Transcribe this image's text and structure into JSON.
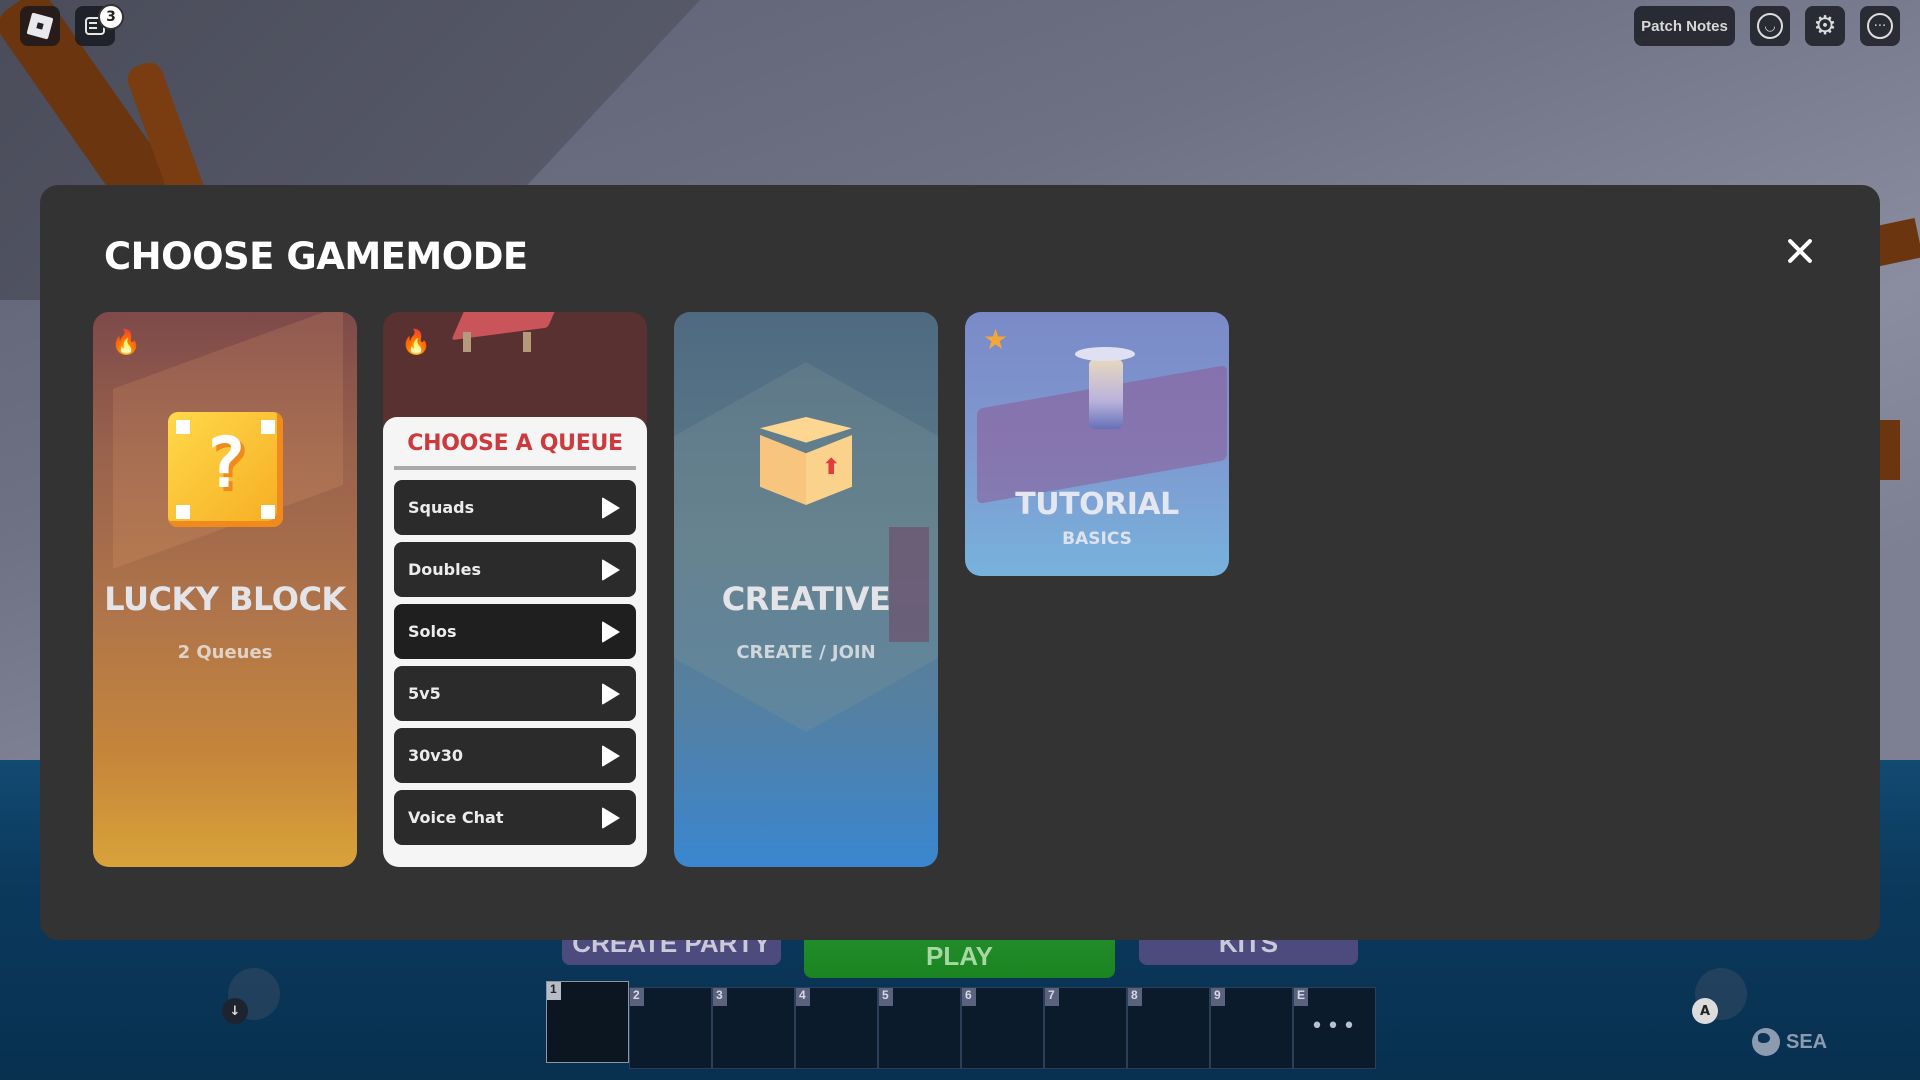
{
  "topbar": {
    "notification_count": "3",
    "patch_notes_label": "Patch Notes"
  },
  "modal": {
    "title": "CHOOSE GAMEMODE",
    "cards": [
      {
        "title": "LUCKY BLOCK",
        "subtitle": "2 Queues",
        "tag_icon": "fire-icon"
      },
      {
        "tag_icon": "fire-icon",
        "queue_panel": {
          "title": "CHOOSE A QUEUE",
          "items": [
            {
              "label": "Squads"
            },
            {
              "label": "Doubles"
            },
            {
              "label": "Solos"
            },
            {
              "label": "5v5"
            },
            {
              "label": "30v30"
            },
            {
              "label": "Voice Chat"
            }
          ]
        }
      },
      {
        "title": "CREATIVE",
        "subtitle": "CREATE / JOIN"
      },
      {
        "title": "TUTORIAL",
        "subtitle": "BASICS",
        "tag_icon": "star-icon"
      }
    ]
  },
  "hud": {
    "create_party_label": "CREATE PARTY",
    "play_label": "PLAY",
    "kits_label": "KITS",
    "hotbar": [
      "1",
      "2",
      "3",
      "4",
      "5",
      "6",
      "7",
      "8",
      "9",
      "E"
    ],
    "hotbar_more": "•••",
    "keys": {
      "left_down": "↓",
      "action": "A"
    },
    "region": "SEA"
  },
  "colors": {
    "modal_bg": "#333333",
    "queue_title": "#cc3a3e",
    "play_green": "#1f8a26",
    "party_purple": "#4d4a7e"
  }
}
